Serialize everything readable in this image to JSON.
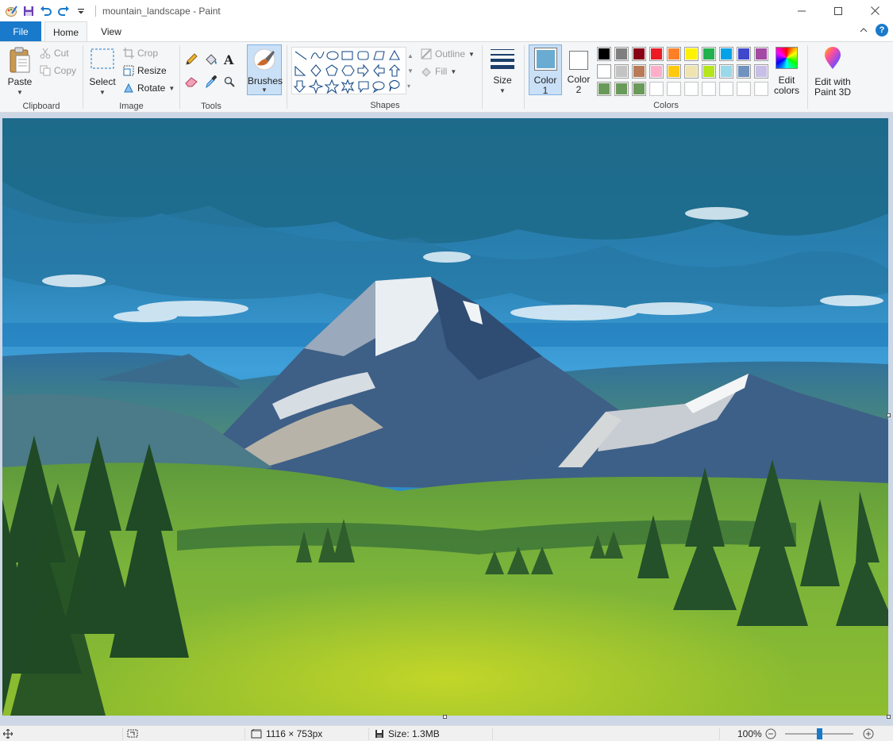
{
  "window": {
    "title": "mountain_landscape - Paint",
    "minimize_icon": "minimize-icon",
    "maximize_icon": "maximize-icon",
    "close_icon": "close-icon"
  },
  "tabs": {
    "file": "File",
    "home": "Home",
    "view": "View"
  },
  "ribbon": {
    "clipboard": {
      "label": "Clipboard",
      "paste": "Paste",
      "cut": "Cut",
      "copy": "Copy"
    },
    "image": {
      "label": "Image",
      "select": "Select",
      "crop": "Crop",
      "resize": "Resize",
      "rotate": "Rotate"
    },
    "tools": {
      "label": "Tools"
    },
    "brushes": {
      "label": "Brushes"
    },
    "shapes": {
      "label": "Shapes",
      "outline": "Outline",
      "fill": "Fill"
    },
    "size": {
      "label": "Size"
    },
    "colors": {
      "label": "Colors",
      "color1_label": "Color",
      "color1_num": "1",
      "color2_label": "Color",
      "color2_num": "2",
      "edit_colors_1": "Edit",
      "edit_colors_2": "colors",
      "paint3d_1": "Edit with",
      "paint3d_2": "Paint 3D",
      "color1_value": "#6aabd2",
      "color2_value": "#ffffff",
      "palette_row1": [
        "#000000",
        "#7f7f7f",
        "#880015",
        "#ed1c24",
        "#ff7f27",
        "#fff200",
        "#22b14c",
        "#00a2e8",
        "#3f48cc",
        "#a349a4"
      ],
      "palette_row2": [
        "#ffffff",
        "#c3c3c3",
        "#b97a57",
        "#ffaec9",
        "#ffc90e",
        "#efe4b0",
        "#b5e61d",
        "#99d9ea",
        "#7092be",
        "#c8bfe7"
      ],
      "palette_row3": [
        "#6a9a5a",
        "#6a9a5a",
        "#6a9a5a",
        "#ffffff",
        "#ffffff",
        "#ffffff",
        "#ffffff",
        "#ffffff",
        "#ffffff",
        "#ffffff"
      ]
    }
  },
  "status": {
    "dimensions": "1116 × 753px",
    "size": "Size: 1.3MB",
    "zoom": "100%",
    "zoom_level": 0.5
  }
}
